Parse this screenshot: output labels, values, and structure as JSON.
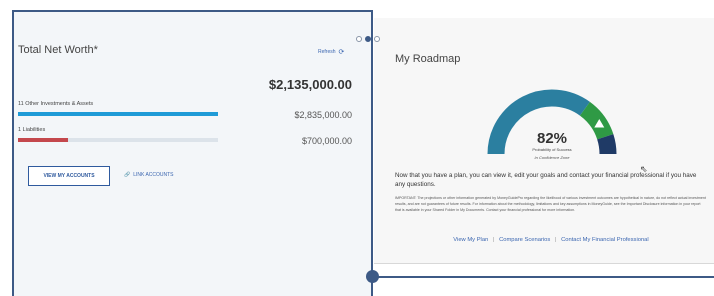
{
  "pager": {
    "count": 3,
    "active": 1
  },
  "net_worth": {
    "title": "Total Net Worth*",
    "refresh_label": "Refresh",
    "refresh_icon": "refresh-icon",
    "total": "$2,135,000.00",
    "rows": [
      {
        "label": "11 Other Investments & Assets",
        "value": "$2,835,000.00",
        "color": "#1f9bd7",
        "fill_fraction": 1.0
      },
      {
        "label": "1 Liabilities",
        "value": "$700,000.00",
        "color": "#c4484d",
        "fill_fraction": 0.25
      }
    ],
    "view_button": "VIEW MY ACCOUNTS",
    "link_label": "LINK ACCOUNTS",
    "link_icon": "link-icon"
  },
  "roadmap": {
    "title": "My Roadmap",
    "probability": "82%",
    "probability_fraction": 0.82,
    "probability_caption": "Probability of Success",
    "zone_label": "In Confidence Zone",
    "colors": {
      "arc": "#2b7fa0",
      "confidence": "#2f9a45",
      "top": "#1f3a66"
    },
    "message": "Now that you have a plan, you can view it, edit your goals and contact your financial professional if you have any questions.",
    "important": "IMPORTANT: The projections or other information generated by MoneyGuidePro regarding the likelihood of various investment outcomes are hypothetical in nature, do not reflect actual investment results, and are not guarantees of future results. For information about the methodology, limitations and key assumptions in MoneyGuide, see the Important Disclosure information in your report that is available in your Shared Folder in My Documents. Contact your financial professional for more information.",
    "links": [
      "View My Plan",
      "Compare Scenarios",
      "Contact My Financial Professional"
    ],
    "separator": "|"
  }
}
